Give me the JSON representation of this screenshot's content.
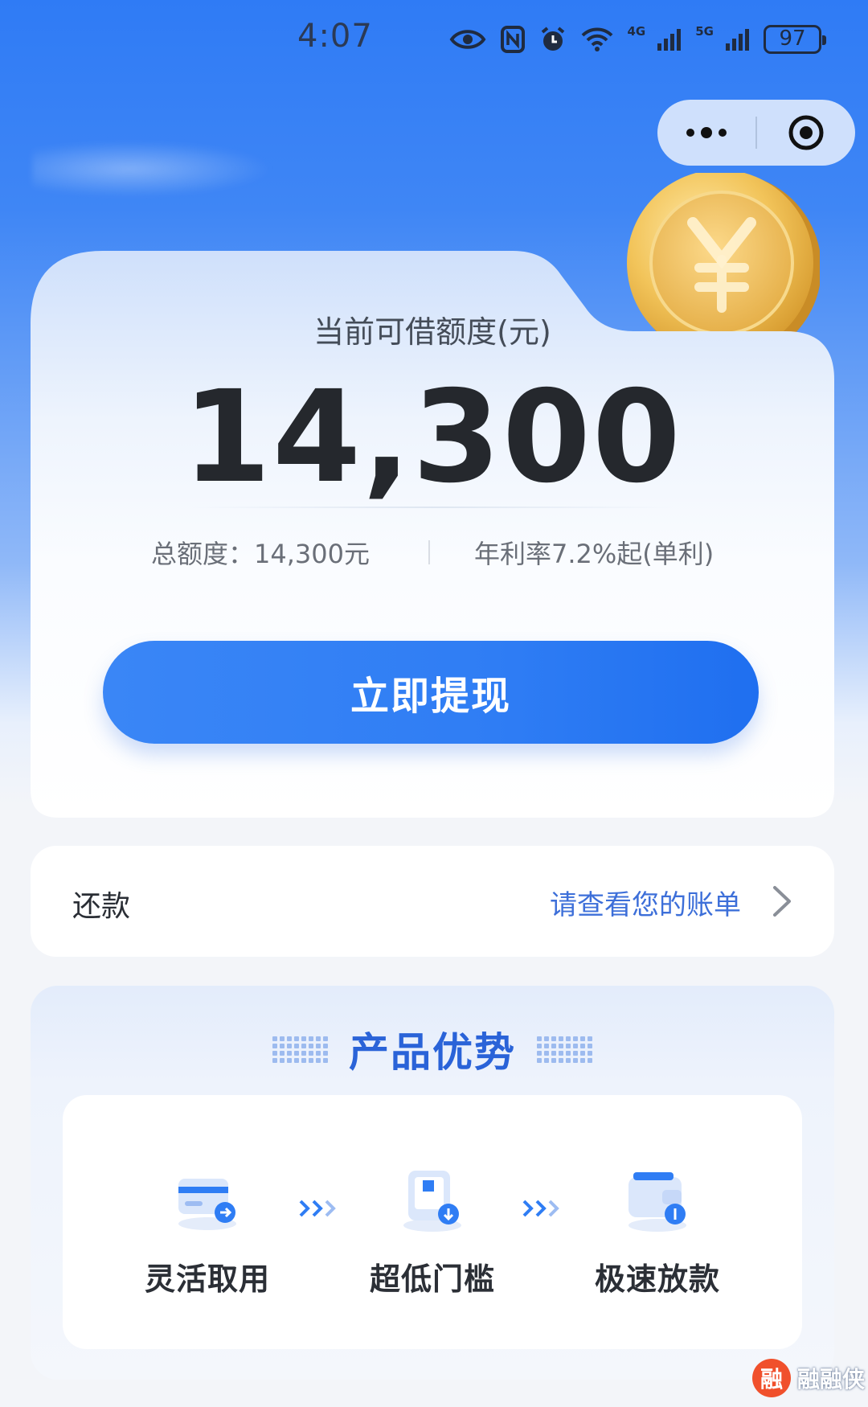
{
  "status_bar": {
    "time": "4:07",
    "network_4g": "4G",
    "network_5g": "5G",
    "battery": "97",
    "icons": [
      "eye-icon",
      "nfc-icon",
      "alarm-icon",
      "wifi-icon",
      "signal-4g-icon",
      "signal-5g-icon",
      "battery-icon"
    ]
  },
  "mini_program_capsule": {
    "icons": [
      "more-dots-icon",
      "close-target-icon"
    ]
  },
  "credit_card": {
    "title": "当前可借额度(元)",
    "amount": "14,300",
    "total_limit": "总额度：14,300元",
    "rate": "年利率7.2%起(单利)",
    "withdraw_button": "立即提现"
  },
  "repay": {
    "label": "还款",
    "link": "请查看您的账单"
  },
  "advantages": {
    "title": "产品优势",
    "items": [
      {
        "label": "灵活取用",
        "icon": "card-icon"
      },
      {
        "label": "超低门槛",
        "icon": "phone-icon"
      },
      {
        "label": "极速放款",
        "icon": "wallet-icon"
      }
    ]
  },
  "watermark": {
    "badge": "融",
    "text": "融融侠"
  },
  "colors": {
    "brand_blue": "#2f7df4",
    "link_blue": "#3d6fd9",
    "title_blue": "#2a63d8",
    "coin_gold": "#f2c45a"
  }
}
